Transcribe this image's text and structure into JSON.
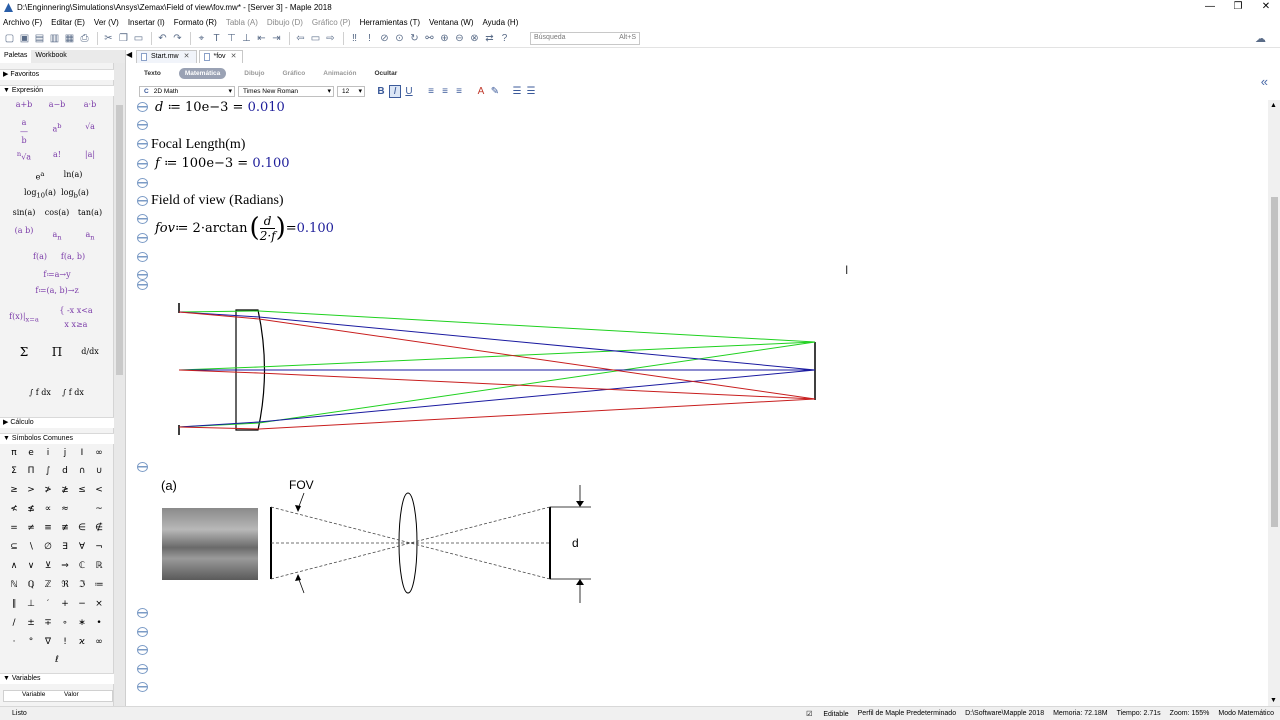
{
  "window": {
    "title": "D:\\Enginnering\\Simulations\\Ansys\\Zemax\\Field of view\\fov.mw* - [Server 3] - Maple 2018",
    "buttons": [
      "—",
      "❐",
      "✕"
    ]
  },
  "menu": [
    {
      "label": "Archivo (F)",
      "enabled": true
    },
    {
      "label": "Editar (E)",
      "enabled": true
    },
    {
      "label": "Ver (V)",
      "enabled": true
    },
    {
      "label": "Insertar (I)",
      "enabled": true
    },
    {
      "label": "Formato (R)",
      "enabled": true
    },
    {
      "label": "Tabla (A)",
      "enabled": false
    },
    {
      "label": "Dibujo (D)",
      "enabled": false
    },
    {
      "label": "Gráfico (P)",
      "enabled": false
    },
    {
      "label": "Herramientas (T)",
      "enabled": true
    },
    {
      "label": "Ventana (W)",
      "enabled": true
    },
    {
      "label": "Ayuda (H)",
      "enabled": true
    }
  ],
  "toolbar": {
    "search_placeholder": "Búsqueda",
    "search_shortcut": "Alt+S"
  },
  "palette": {
    "tabs": [
      "Paletas",
      "Workbook"
    ],
    "sections": {
      "favoritos": "Favoritos",
      "expresion": "Expresión",
      "calculo": "Cálculo",
      "simbolos": "Símbolos Comunes",
      "variables": "Variables"
    },
    "var_cols": [
      "Variable",
      "Valor"
    ]
  },
  "doc_tabs": [
    {
      "label": "Start.mw",
      "close": "✕"
    },
    {
      "label": "*fov",
      "close": "✕"
    }
  ],
  "modes": [
    "Texto",
    "Matemática",
    "Dibujo",
    "Gráfico",
    "Animación",
    "Ocultar"
  ],
  "format": {
    "style": "2D Math",
    "font": "Times New Roman",
    "size": "12"
  },
  "document": {
    "line1": {
      "var": "d",
      "expr": " ≔ 10e−3 = ",
      "result": "0.010"
    },
    "label_focal": "Focal Length(m)",
    "line2": {
      "var": "f",
      "expr": " ≔ 100e−3 = ",
      "result": "0.100"
    },
    "label_fov": "Field of view (Radians)",
    "line3": {
      "var": "fov",
      "expr": " ≔ 2·arctan",
      "num": "d",
      "den": "2·f",
      "eq": " = ",
      "result": "0.100"
    },
    "fig_a": "(a)",
    "fig_fov": "FOV",
    "fig_d": "d"
  },
  "colors": {
    "green": "#1fd11f",
    "red": "#c81e1e",
    "blue": "#1a1aa0",
    "accent": "#3b5a9a"
  },
  "status": {
    "left": "Listo",
    "items": [
      "Editable",
      "Perfil de Maple Predeterminado",
      "D:\\Software\\Mapple 2018",
      "Memoria: 72.18M",
      "Tiempo: 2.71s",
      "Zoom: 155%",
      "Modo Matemático"
    ]
  }
}
